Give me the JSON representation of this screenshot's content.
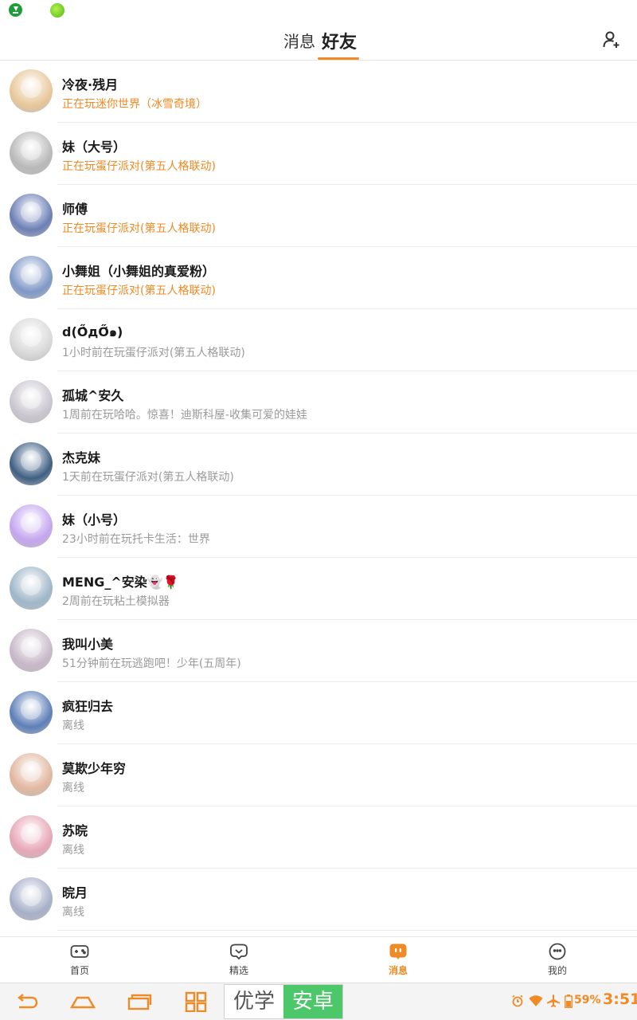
{
  "header": {
    "tabs": [
      "消息",
      "好友"
    ],
    "active_tab": "好友"
  },
  "friends": [
    {
      "name": "冷夜·残月",
      "status": "正在玩迷你世界（冰雪奇境）",
      "state": "playing",
      "avatar_color": "#e8c79a"
    },
    {
      "name": "妹（大号）",
      "status": "正在玩蛋仔派对(第五人格联动)",
      "state": "playing",
      "avatar_color": "#b9b9b9"
    },
    {
      "name": "师傅",
      "status": "正在玩蛋仔派对(第五人格联动)",
      "state": "playing",
      "avatar_color": "#6c7fb6"
    },
    {
      "name": "小舞姐（小舞姐的真爱粉）",
      "status": "正在玩蛋仔派对(第五人格联动)",
      "state": "playing",
      "avatar_color": "#7f98c7"
    },
    {
      "name": "d(Ő̀дŐ́๑)",
      "status": "1小时前在玩蛋仔派对(第五人格联动)",
      "state": "idle",
      "avatar_color": "#d9d9d9"
    },
    {
      "name": "孤城^安久",
      "status": "1周前在玩哈哈。惊喜！迪斯科屋-收集可爱的娃娃",
      "state": "idle",
      "avatar_color": "#c9c6cf"
    },
    {
      "name": "杰克妹",
      "status": "1天前在玩蛋仔派对(第五人格联动)",
      "state": "idle",
      "avatar_color": "#3f5f83"
    },
    {
      "name": "妹（小号）",
      "status": "23小时前在玩托卡生活：世界",
      "state": "idle",
      "avatar_color": "#c4a6ef"
    },
    {
      "name": "MENG_^安染👻🌹",
      "status": "2周前在玩粘土模拟器",
      "state": "idle",
      "avatar_color": "#9fb7c9"
    },
    {
      "name": "我叫小美",
      "status": "51分钟前在玩逃跑吧！少年(五周年)",
      "state": "idle",
      "avatar_color": "#c8b8c8"
    },
    {
      "name": "疯狂归去",
      "status": "离线",
      "state": "idle",
      "avatar_color": "#5e7fb8"
    },
    {
      "name": "莫欺少年穷",
      "status": "离线",
      "state": "idle",
      "avatar_color": "#e2b7a0"
    },
    {
      "name": "苏晥",
      "status": "离线",
      "state": "idle",
      "avatar_color": "#e7a7b7"
    },
    {
      "name": "晥月",
      "status": "离线",
      "state": "idle",
      "avatar_color": "#a7b0c9"
    }
  ],
  "bottom_nav": [
    {
      "label": "首页",
      "icon": "gamepad-icon",
      "active": false
    },
    {
      "label": "精选",
      "icon": "heart-chat-icon",
      "active": false
    },
    {
      "label": "消息",
      "icon": "chat-icon",
      "active": true
    },
    {
      "label": "我的",
      "icon": "smiley-icon",
      "active": false
    }
  ],
  "system_bar": {
    "ime_left": "优学",
    "ime_right": "安卓",
    "battery": "59%",
    "time": "3:51"
  },
  "colors": {
    "accent": "#f08a24",
    "ime_green": "#4cc86a",
    "idle_text": "#9a9a9a"
  }
}
